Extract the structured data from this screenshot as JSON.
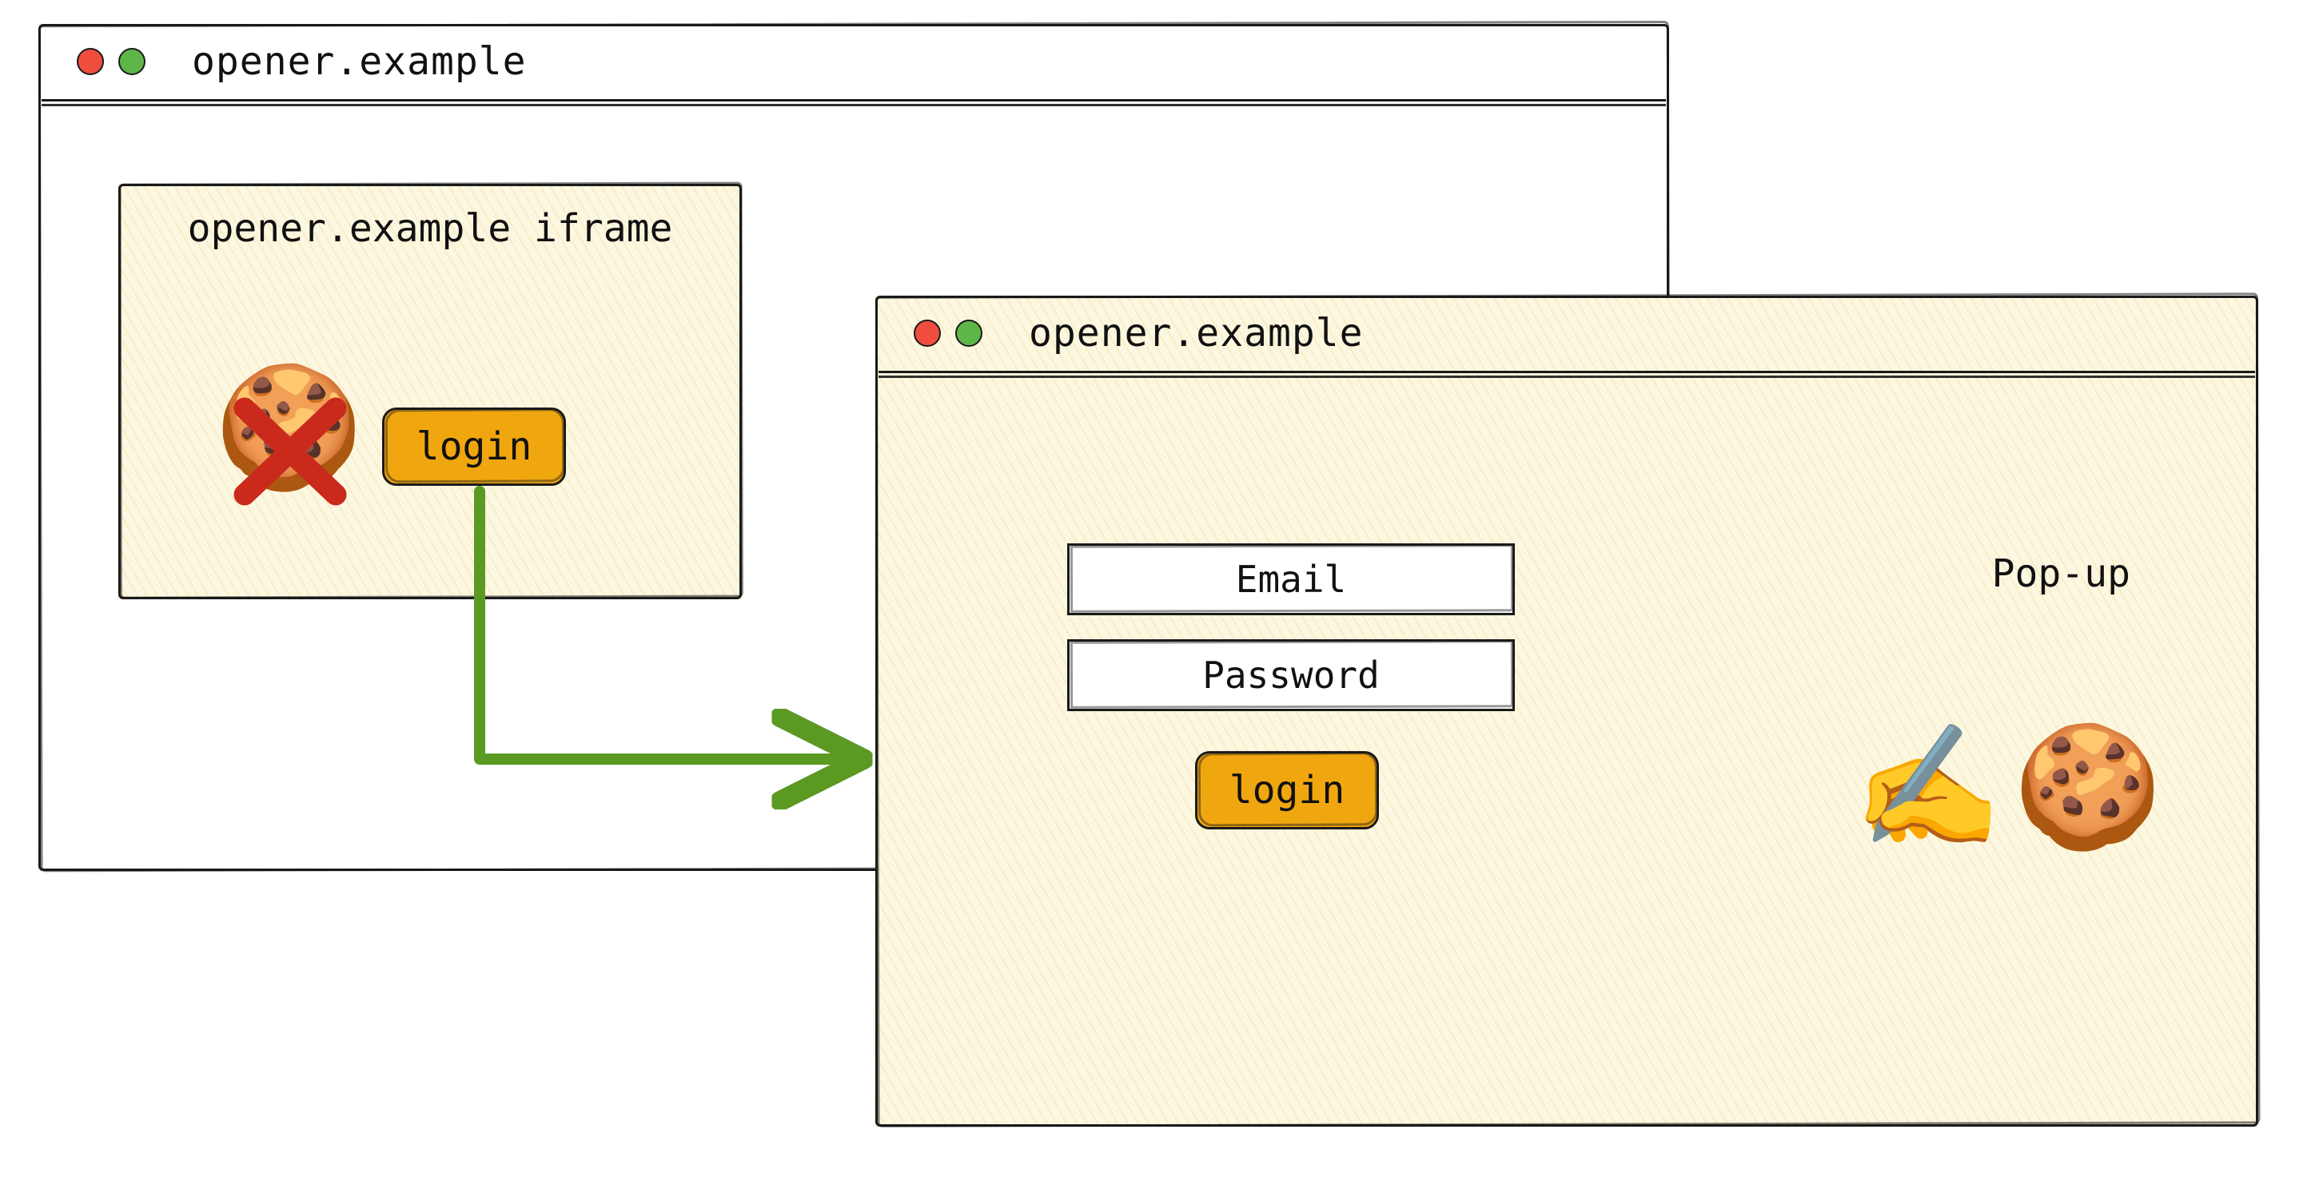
{
  "opener_window": {
    "title": "opener.example",
    "iframe": {
      "label": "opener.example iframe",
      "login_button_label": "login",
      "cookie_blocked": true
    }
  },
  "popup_window": {
    "title": "opener.example",
    "label": "Pop-up",
    "email_field_label": "Email",
    "password_field_label": "Password",
    "login_button_label": "login",
    "cookie_writable": true
  },
  "icons": {
    "cookie": "🍪",
    "cross": "❌",
    "writing_hand": "✍️"
  },
  "colors": {
    "button_bg": "#f0a70f",
    "hatch_bg": "#fcf7e0",
    "arrow": "#5a9a23",
    "dot_red": "#ef4e3f",
    "dot_green": "#5fb648"
  }
}
